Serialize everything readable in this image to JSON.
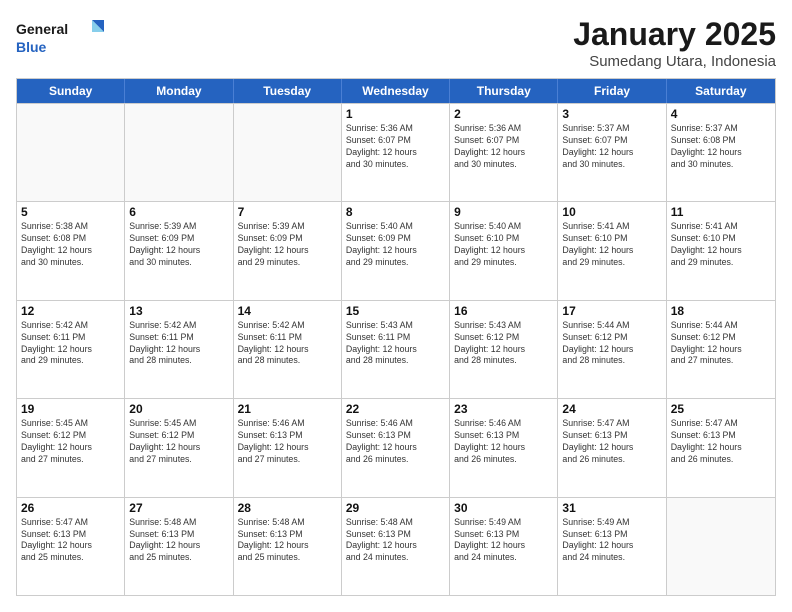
{
  "logo": {
    "line1": "General",
    "line2": "Blue"
  },
  "title": "January 2025",
  "subtitle": "Sumedang Utara, Indonesia",
  "weekdays": [
    "Sunday",
    "Monday",
    "Tuesday",
    "Wednesday",
    "Thursday",
    "Friday",
    "Saturday"
  ],
  "rows": [
    [
      {
        "day": "",
        "info": ""
      },
      {
        "day": "",
        "info": ""
      },
      {
        "day": "",
        "info": ""
      },
      {
        "day": "1",
        "info": "Sunrise: 5:36 AM\nSunset: 6:07 PM\nDaylight: 12 hours\nand 30 minutes."
      },
      {
        "day": "2",
        "info": "Sunrise: 5:36 AM\nSunset: 6:07 PM\nDaylight: 12 hours\nand 30 minutes."
      },
      {
        "day": "3",
        "info": "Sunrise: 5:37 AM\nSunset: 6:07 PM\nDaylight: 12 hours\nand 30 minutes."
      },
      {
        "day": "4",
        "info": "Sunrise: 5:37 AM\nSunset: 6:08 PM\nDaylight: 12 hours\nand 30 minutes."
      }
    ],
    [
      {
        "day": "5",
        "info": "Sunrise: 5:38 AM\nSunset: 6:08 PM\nDaylight: 12 hours\nand 30 minutes."
      },
      {
        "day": "6",
        "info": "Sunrise: 5:39 AM\nSunset: 6:09 PM\nDaylight: 12 hours\nand 30 minutes."
      },
      {
        "day": "7",
        "info": "Sunrise: 5:39 AM\nSunset: 6:09 PM\nDaylight: 12 hours\nand 29 minutes."
      },
      {
        "day": "8",
        "info": "Sunrise: 5:40 AM\nSunset: 6:09 PM\nDaylight: 12 hours\nand 29 minutes."
      },
      {
        "day": "9",
        "info": "Sunrise: 5:40 AM\nSunset: 6:10 PM\nDaylight: 12 hours\nand 29 minutes."
      },
      {
        "day": "10",
        "info": "Sunrise: 5:41 AM\nSunset: 6:10 PM\nDaylight: 12 hours\nand 29 minutes."
      },
      {
        "day": "11",
        "info": "Sunrise: 5:41 AM\nSunset: 6:10 PM\nDaylight: 12 hours\nand 29 minutes."
      }
    ],
    [
      {
        "day": "12",
        "info": "Sunrise: 5:42 AM\nSunset: 6:11 PM\nDaylight: 12 hours\nand 29 minutes."
      },
      {
        "day": "13",
        "info": "Sunrise: 5:42 AM\nSunset: 6:11 PM\nDaylight: 12 hours\nand 28 minutes."
      },
      {
        "day": "14",
        "info": "Sunrise: 5:42 AM\nSunset: 6:11 PM\nDaylight: 12 hours\nand 28 minutes."
      },
      {
        "day": "15",
        "info": "Sunrise: 5:43 AM\nSunset: 6:11 PM\nDaylight: 12 hours\nand 28 minutes."
      },
      {
        "day": "16",
        "info": "Sunrise: 5:43 AM\nSunset: 6:12 PM\nDaylight: 12 hours\nand 28 minutes."
      },
      {
        "day": "17",
        "info": "Sunrise: 5:44 AM\nSunset: 6:12 PM\nDaylight: 12 hours\nand 28 minutes."
      },
      {
        "day": "18",
        "info": "Sunrise: 5:44 AM\nSunset: 6:12 PM\nDaylight: 12 hours\nand 27 minutes."
      }
    ],
    [
      {
        "day": "19",
        "info": "Sunrise: 5:45 AM\nSunset: 6:12 PM\nDaylight: 12 hours\nand 27 minutes."
      },
      {
        "day": "20",
        "info": "Sunrise: 5:45 AM\nSunset: 6:12 PM\nDaylight: 12 hours\nand 27 minutes."
      },
      {
        "day": "21",
        "info": "Sunrise: 5:46 AM\nSunset: 6:13 PM\nDaylight: 12 hours\nand 27 minutes."
      },
      {
        "day": "22",
        "info": "Sunrise: 5:46 AM\nSunset: 6:13 PM\nDaylight: 12 hours\nand 26 minutes."
      },
      {
        "day": "23",
        "info": "Sunrise: 5:46 AM\nSunset: 6:13 PM\nDaylight: 12 hours\nand 26 minutes."
      },
      {
        "day": "24",
        "info": "Sunrise: 5:47 AM\nSunset: 6:13 PM\nDaylight: 12 hours\nand 26 minutes."
      },
      {
        "day": "25",
        "info": "Sunrise: 5:47 AM\nSunset: 6:13 PM\nDaylight: 12 hours\nand 26 minutes."
      }
    ],
    [
      {
        "day": "26",
        "info": "Sunrise: 5:47 AM\nSunset: 6:13 PM\nDaylight: 12 hours\nand 25 minutes."
      },
      {
        "day": "27",
        "info": "Sunrise: 5:48 AM\nSunset: 6:13 PM\nDaylight: 12 hours\nand 25 minutes."
      },
      {
        "day": "28",
        "info": "Sunrise: 5:48 AM\nSunset: 6:13 PM\nDaylight: 12 hours\nand 25 minutes."
      },
      {
        "day": "29",
        "info": "Sunrise: 5:48 AM\nSunset: 6:13 PM\nDaylight: 12 hours\nand 24 minutes."
      },
      {
        "day": "30",
        "info": "Sunrise: 5:49 AM\nSunset: 6:13 PM\nDaylight: 12 hours\nand 24 minutes."
      },
      {
        "day": "31",
        "info": "Sunrise: 5:49 AM\nSunset: 6:13 PM\nDaylight: 12 hours\nand 24 minutes."
      },
      {
        "day": "",
        "info": ""
      }
    ]
  ]
}
